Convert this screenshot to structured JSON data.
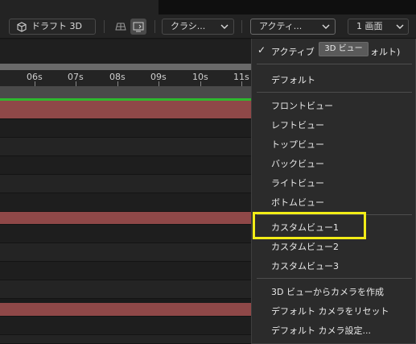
{
  "toolbar": {
    "draft3d_label": "ドラフト 3D",
    "renderer_label": "クラシ...",
    "view_label": "アクティ...",
    "layout_label": "1 画面"
  },
  "ruler": {
    "ticks": [
      "06s",
      "07s",
      "08s",
      "09s",
      "10s",
      "11s"
    ]
  },
  "menu": {
    "active_camera": "アクティブカメラ (デフォルト)",
    "active_camera_visible": "アクティブ",
    "active_camera_tail": "ォルト)",
    "default": "デフォルト",
    "front": "フロントビュー",
    "left": "レフトビュー",
    "top": "トップビュー",
    "back": "バックビュー",
    "right": "ライトビュー",
    "bottom": "ボトムビュー",
    "custom1": "カスタムビュー1",
    "custom2": "カスタムビュー2",
    "custom3": "カスタムビュー3",
    "create_camera": "3D ビューからカメラを作成",
    "reset_camera": "デフォルト カメラをリセット",
    "camera_settings": "デフォルト カメラ設定..."
  },
  "tooltip": "3D ビュー",
  "colors": {
    "highlight": "#f2ec17",
    "track_red": "#8f4848",
    "green_bar": "#2fb82f"
  }
}
